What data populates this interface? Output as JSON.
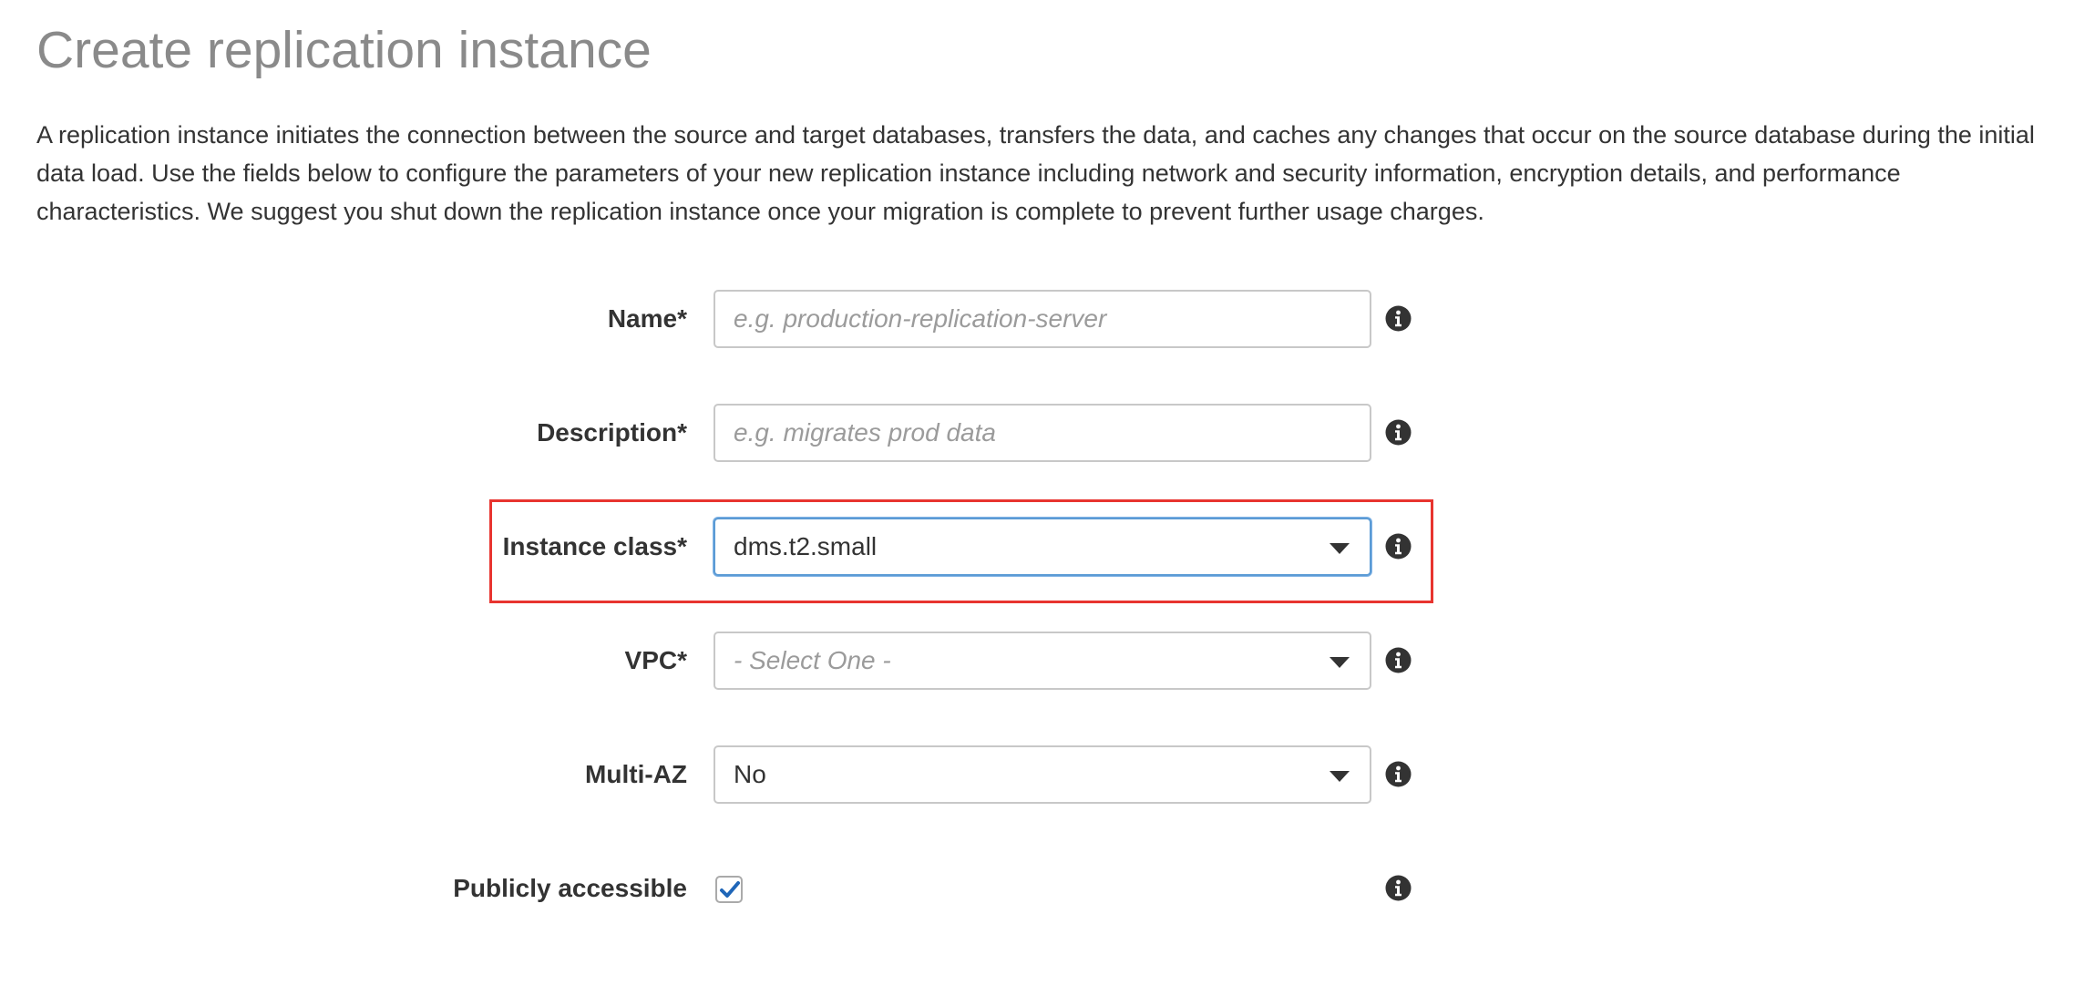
{
  "page": {
    "title": "Create replication instance",
    "description": "A replication instance initiates the connection between the source and target databases, transfers the data, and caches any changes that occur on the source database during the initial data load. Use the fields below to configure the parameters of your new replication instance including network and security information, encryption details, and performance characteristics. We suggest you shut down the replication instance once your migration is complete to prevent further usage charges."
  },
  "form": {
    "name": {
      "label": "Name*",
      "value": "",
      "placeholder": "e.g. production-replication-server",
      "icon": "info-icon"
    },
    "description": {
      "label": "Description*",
      "value": "",
      "placeholder": "e.g. migrates prod data",
      "icon": "info-icon"
    },
    "instance_class": {
      "label": "Instance class*",
      "selected": "dms.t2.small",
      "icon": "info-icon"
    },
    "vpc": {
      "label": "VPC*",
      "placeholder": "- Select One -",
      "icon": "info-icon"
    },
    "multi_az": {
      "label": "Multi-AZ",
      "selected": "No",
      "icon": "info-icon"
    },
    "publicly_accessible": {
      "label": "Publicly accessible",
      "checked": true,
      "icon": "info-icon"
    }
  },
  "colors": {
    "title": "#8a8a8a",
    "text": "#333333",
    "highlight_border": "#e8342f",
    "focus_border": "#5b9bd5",
    "checkmark": "#1f66b8"
  }
}
